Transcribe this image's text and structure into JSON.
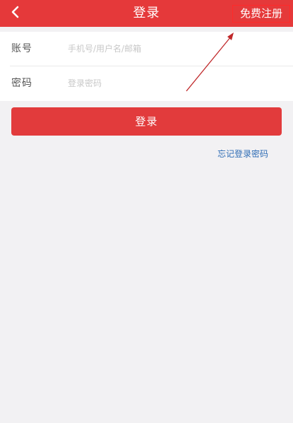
{
  "header": {
    "back_icon": "chevron-left-icon",
    "title": "登录",
    "register_label": "免费注册",
    "bg_color": "#e5393a"
  },
  "form": {
    "account": {
      "label": "账号",
      "placeholder": "手机号/用户名/邮箱",
      "value": ""
    },
    "password": {
      "label": "密码",
      "placeholder": "登录密码",
      "value": ""
    }
  },
  "login_button": {
    "label": "登录",
    "color": "#e23b3c"
  },
  "forgot_password": {
    "label": "忘记登录密码",
    "color": "#2f6db5"
  },
  "annotation": {
    "highlight_color": "#ff2a2a",
    "arrow_color": "#c0282a"
  }
}
